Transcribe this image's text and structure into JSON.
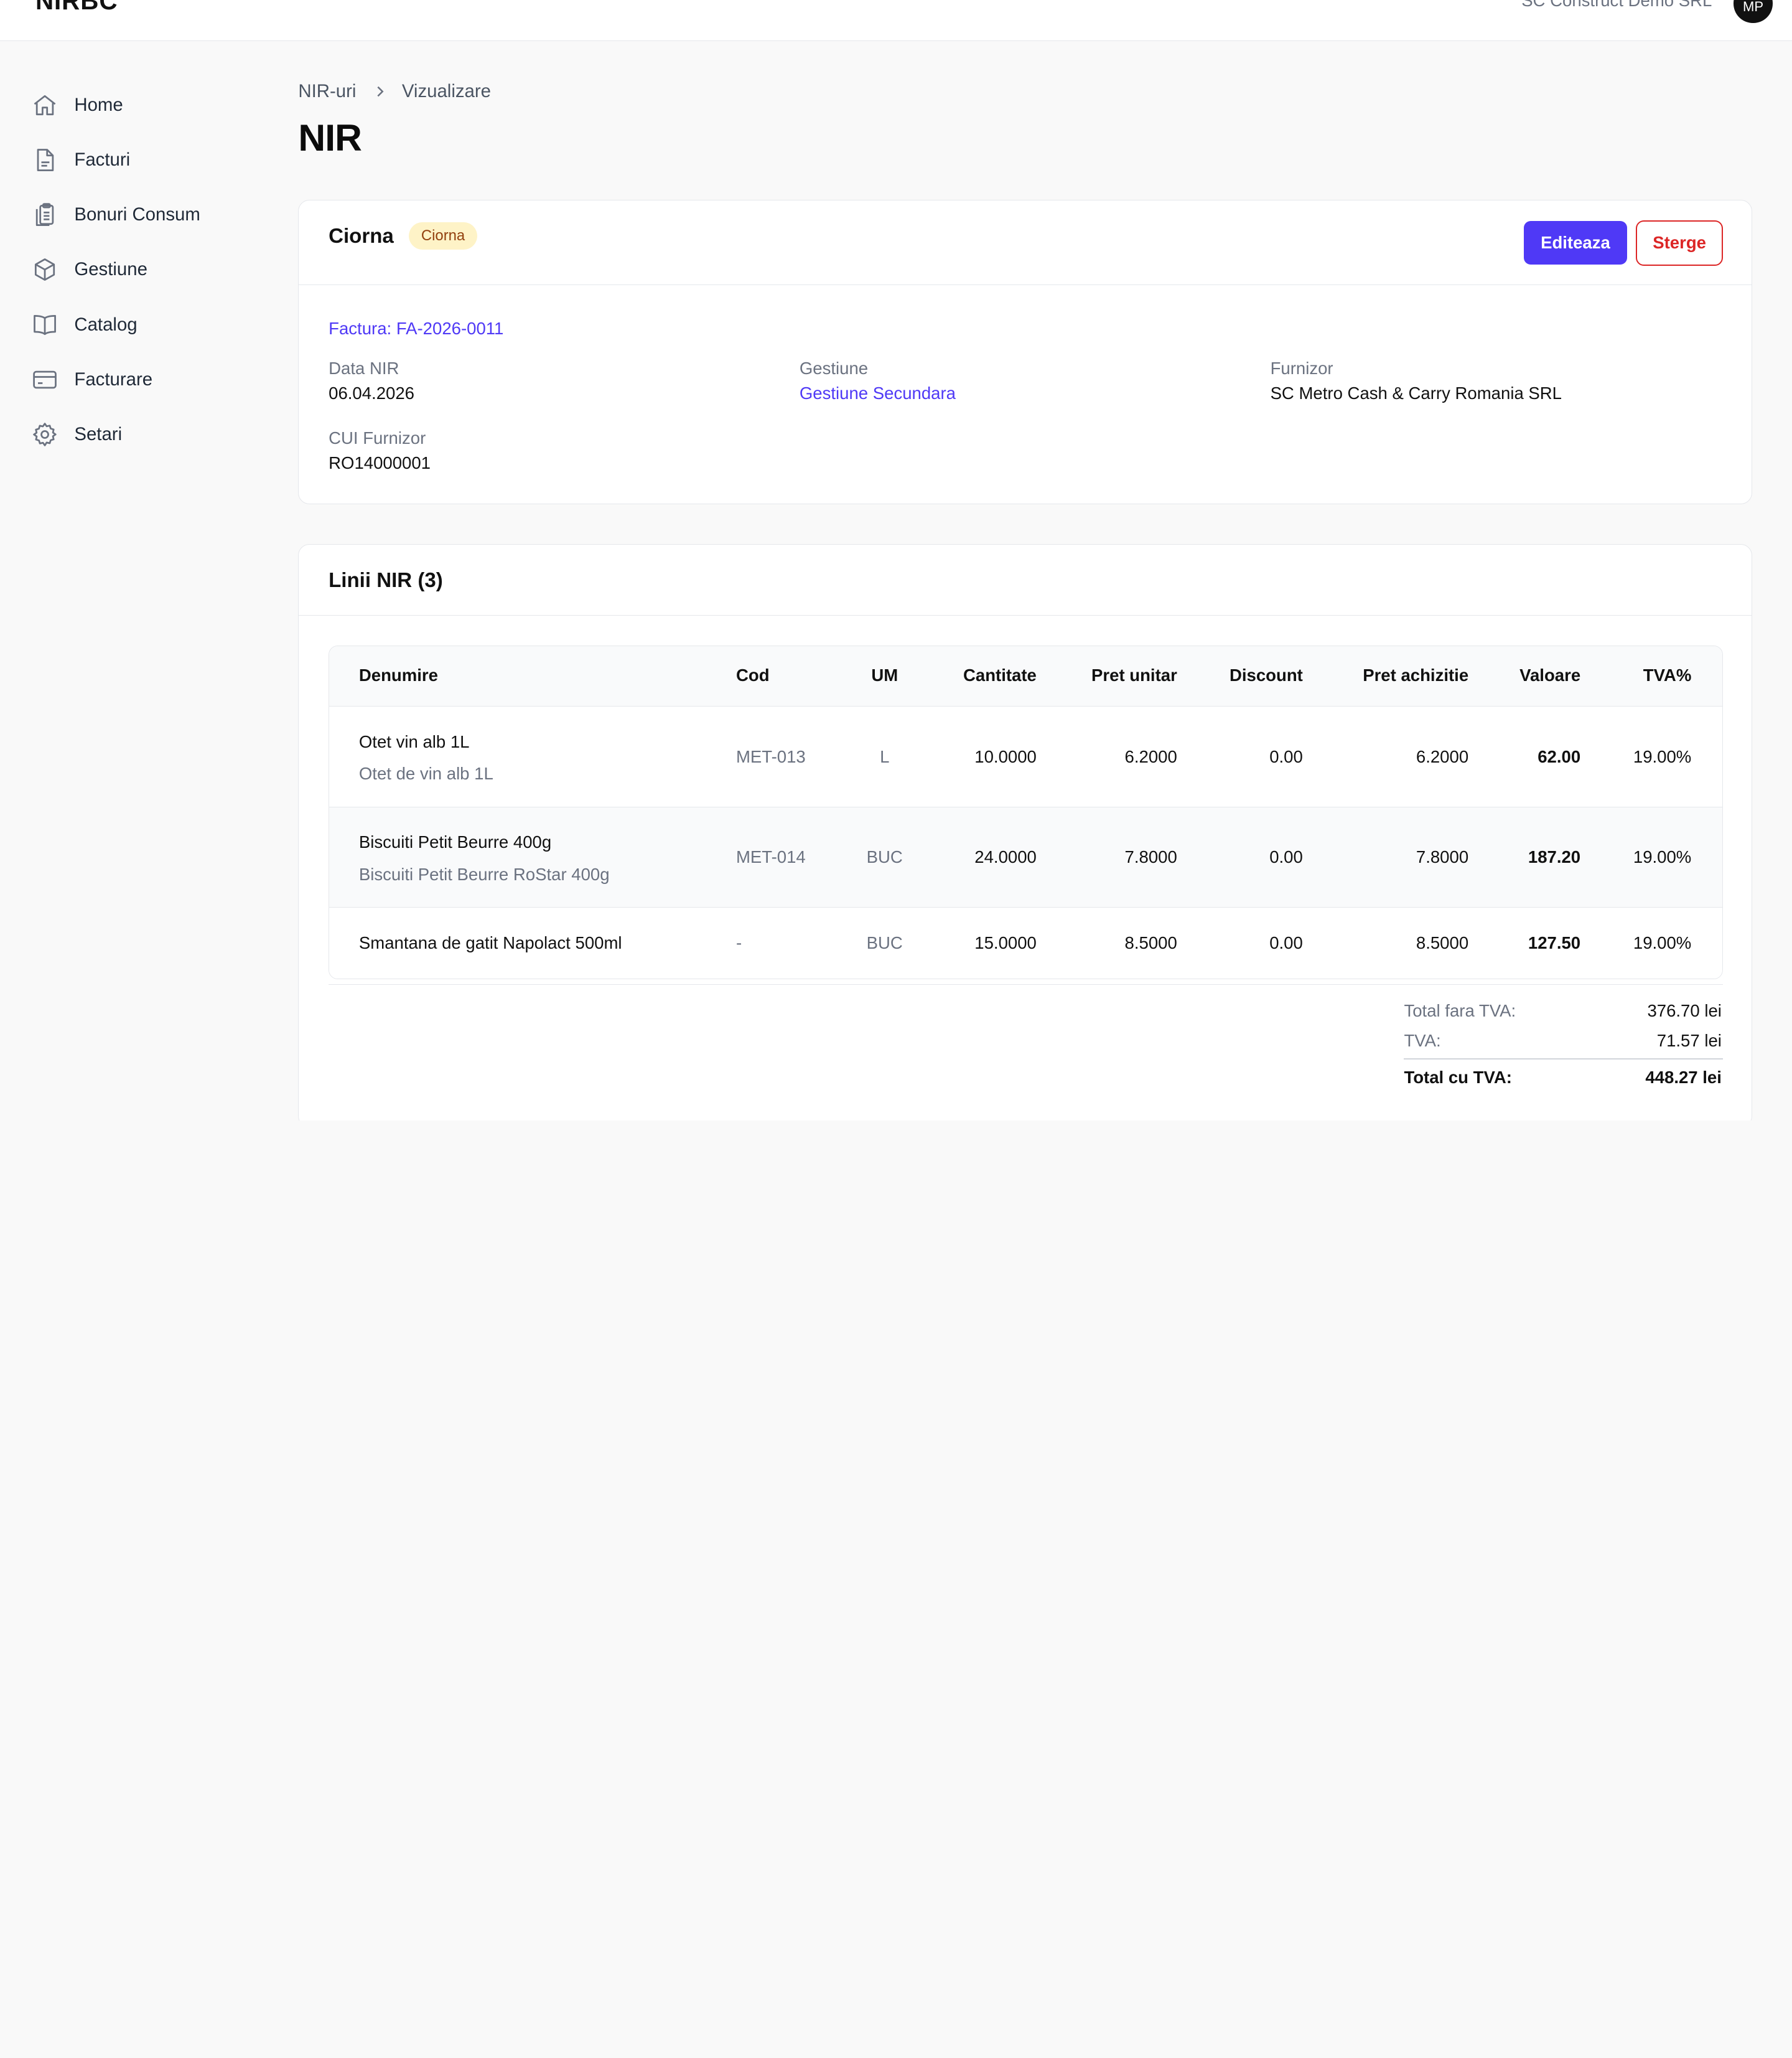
{
  "app": {
    "brand": "NIRBC",
    "company": "SC Construct Demo SRL",
    "avatar_initials": "MP"
  },
  "sidebar": {
    "items": [
      {
        "label": "Home",
        "icon": "home-icon"
      },
      {
        "label": "Facturi",
        "icon": "document-icon"
      },
      {
        "label": "Bonuri Consum",
        "icon": "clipboard-icon"
      },
      {
        "label": "Gestiune",
        "icon": "box-icon"
      },
      {
        "label": "Catalog",
        "icon": "book-icon"
      },
      {
        "label": "Facturare",
        "icon": "credit-card-icon"
      },
      {
        "label": "Setari",
        "icon": "gear-icon"
      }
    ]
  },
  "breadcrumb": {
    "parent": "NIR-uri",
    "current": "Vizualizare"
  },
  "page": {
    "title": "NIR"
  },
  "details": {
    "status_title": "Ciorna",
    "status_badge": "Ciorna",
    "badge_color": "#fef3c7",
    "edit_label": "Editeaza",
    "delete_label": "Sterge",
    "invoice_link": "Factura: FA-2026-0011",
    "fields": {
      "data_nir": {
        "label": "Data NIR",
        "value": "06.04.2026"
      },
      "gestiune": {
        "label": "Gestiune",
        "value": "Gestiune Secundara"
      },
      "furnizor": {
        "label": "Furnizor",
        "value": "SC Metro Cash & Carry Romania SRL"
      },
      "cui": {
        "label": "CUI Furnizor",
        "value": "RO14000001"
      }
    }
  },
  "lines": {
    "title": "Linii NIR (3)",
    "columns": {
      "denumire": "Denumire",
      "cod": "Cod",
      "um": "UM",
      "cantitate": "Cantitate",
      "pret_unitar": "Pret unitar",
      "discount": "Discount",
      "pret_achizitie": "Pret achizitie",
      "valoare": "Valoare",
      "tva": "TVA%"
    },
    "rows": [
      {
        "denumire": "Otet vin alb 1L",
        "subtitle": "Otet de vin alb 1L",
        "cod": "MET-013",
        "um": "L",
        "cantitate": "10.0000",
        "pret_unitar": "6.2000",
        "discount": "0.00",
        "pret_achizitie": "6.2000",
        "valoare": "62.00",
        "tva": "19.00%"
      },
      {
        "denumire": "Biscuiti Petit Beurre 400g",
        "subtitle": "Biscuiti Petit Beurre RoStar 400g",
        "cod": "MET-014",
        "um": "BUC",
        "cantitate": "24.0000",
        "pret_unitar": "7.8000",
        "discount": "0.00",
        "pret_achizitie": "7.8000",
        "valoare": "187.20",
        "tva": "19.00%"
      },
      {
        "denumire": "Smantana de gatit Napolact 500ml",
        "subtitle": "",
        "cod": "-",
        "um": "BUC",
        "cantitate": "15.0000",
        "pret_unitar": "8.5000",
        "discount": "0.00",
        "pret_achizitie": "8.5000",
        "valoare": "127.50",
        "tva": "19.00%"
      }
    ]
  },
  "totals": {
    "fara_tva_label": "Total fara TVA:",
    "fara_tva_value": "376.70 lei",
    "tva_label": "TVA:",
    "tva_value": "71.57 lei",
    "cu_tva_label": "Total cu TVA:",
    "cu_tva_value": "448.27 lei"
  },
  "colors": {
    "accent": "#4f39f6",
    "danger": "#dc2626"
  }
}
